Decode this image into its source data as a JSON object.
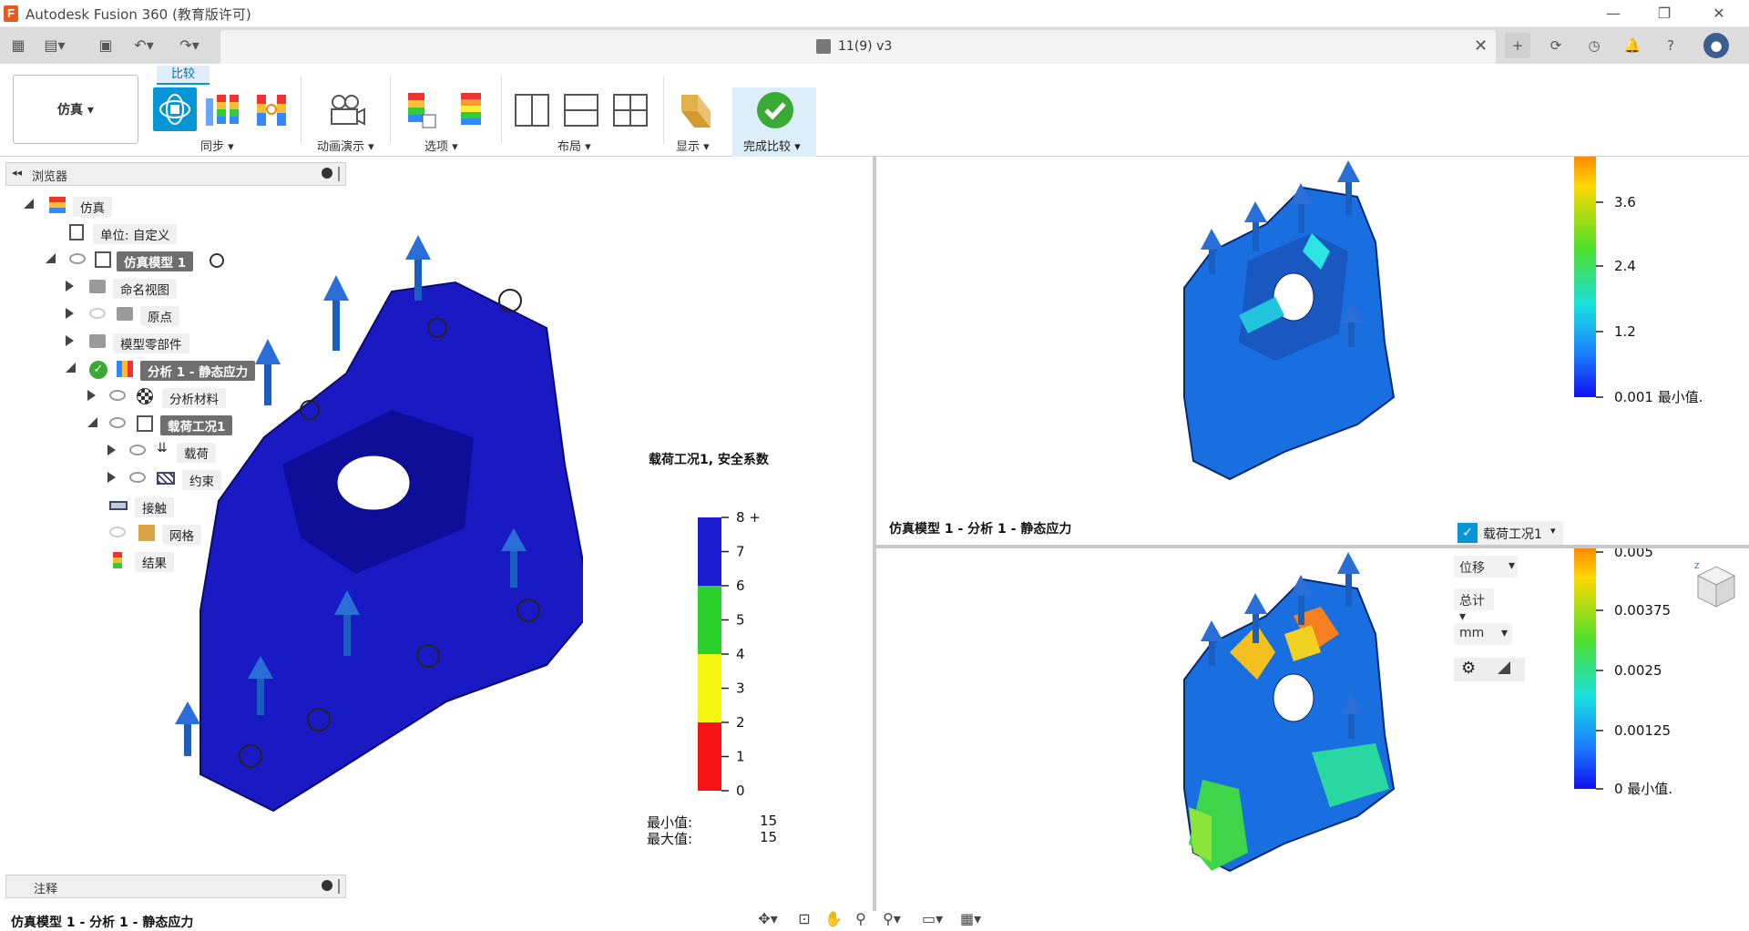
{
  "window": {
    "title": "Autodesk Fusion 360 (教育版许可)"
  },
  "doc_tab": {
    "name": "11(9) v3"
  },
  "toolbar": {
    "workspace": "仿真",
    "workspace_caret": "▾",
    "compare_tab": "比较",
    "groups": {
      "sync": "同步",
      "animate": "动画演示",
      "options": "选项",
      "layout": "布局",
      "display": "显示",
      "finish": "完成比较"
    }
  },
  "browser": {
    "title": "浏览器",
    "nodes": {
      "sim": "仿真",
      "units": "单位: 自定义",
      "model": "仿真模型 1",
      "named_views": "命名视图",
      "origin": "原点",
      "model_parts": "模型零部件",
      "analysis": "分析 1 - 静态应力",
      "materials": "分析材料",
      "loadcase": "载荷工况1",
      "loads": "载荷",
      "constraints": "约束",
      "contacts": "接触",
      "mesh": "网格",
      "results": "结果"
    }
  },
  "comments": {
    "title": "注释"
  },
  "left_view": {
    "legend_title": "载荷工况1, 安全系数",
    "ticks": [
      "8 +",
      "7",
      "6",
      "5",
      "4",
      "3",
      "2",
      "1",
      "0"
    ],
    "colors": [
      "#1a1acf",
      "#1a1acf",
      "#2ad12a",
      "#2ad12a",
      "#f4f410",
      "#f4f410",
      "#f41414",
      "#f41414"
    ],
    "min_label": "最小值:",
    "max_label": "最大值:",
    "min_value": "15",
    "max_value": "15",
    "footer": "仿真模型 1 - 分析 1 - 静态应力"
  },
  "top_right_view": {
    "ticks": [
      "3.6",
      "2.4",
      "1.2",
      "0.001 最小值."
    ],
    "footer": "仿真模型 1 - 分析 1 - 静态应力",
    "loadcase_dropdown": "载荷工况1"
  },
  "bottom_right_view": {
    "ticks": [
      "0.005",
      "0.00375",
      "0.0025",
      "0.00125",
      "0 最小值."
    ],
    "result_type": "位移",
    "component": "总计",
    "unit": "mm"
  }
}
